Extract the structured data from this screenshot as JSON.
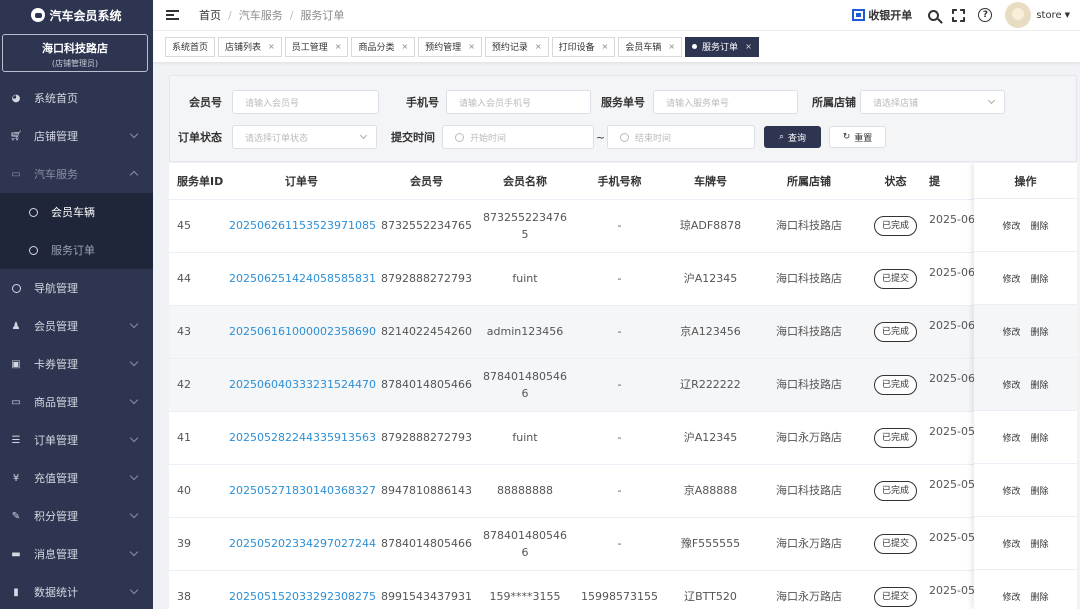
{
  "app": {
    "title": "汽车会员系统"
  },
  "store": {
    "name": "海口科技路店",
    "role": "(店铺管理员)"
  },
  "menu": {
    "items": [
      {
        "label": "系统首页",
        "icon": "dashboard-icon"
      },
      {
        "label": "店铺管理",
        "icon": "cart-icon"
      },
      {
        "label": "汽车服务",
        "icon": "briefcase-icon"
      },
      {
        "label": "导航管理",
        "icon": "compass-icon"
      },
      {
        "label": "会员管理",
        "icon": "users-icon"
      },
      {
        "label": "卡券管理",
        "icon": "ticket-icon"
      },
      {
        "label": "商品管理",
        "icon": "monitor-icon"
      },
      {
        "label": "订单管理",
        "icon": "list-icon"
      },
      {
        "label": "充值管理",
        "icon": "yen-icon"
      },
      {
        "label": "积分管理",
        "icon": "edit-icon"
      },
      {
        "label": "消息管理",
        "icon": "message-icon"
      },
      {
        "label": "数据统计",
        "icon": "chart-icon"
      }
    ],
    "sub": [
      {
        "label": "会员车辆"
      },
      {
        "label": "服务订单"
      }
    ]
  },
  "header": {
    "breadcrumb": [
      "首页",
      "汽车服务",
      "服务订单"
    ],
    "cashier": "收银开单",
    "username": "store"
  },
  "tabs": [
    {
      "label": "系统首页",
      "closable": false
    },
    {
      "label": "店铺列表",
      "closable": true
    },
    {
      "label": "员工管理",
      "closable": true
    },
    {
      "label": "商品分类",
      "closable": true
    },
    {
      "label": "预约管理",
      "closable": true
    },
    {
      "label": "预约记录",
      "closable": true
    },
    {
      "label": "打印设备",
      "closable": true
    },
    {
      "label": "会员车辆",
      "closable": true
    },
    {
      "label": "服务订单",
      "closable": true,
      "active": true
    }
  ],
  "filter": {
    "member_no": {
      "label": "会员号",
      "placeholder": "请输入会员号"
    },
    "phone": {
      "label": "手机号",
      "placeholder": "请输入会员手机号"
    },
    "service_no": {
      "label": "服务单号",
      "placeholder": "请输入服务单号"
    },
    "store": {
      "label": "所属店铺",
      "placeholder": "请选择店铺"
    },
    "order_status": {
      "label": "订单状态",
      "placeholder": "请选择订单状态"
    },
    "submit_time": {
      "label": "提交时间",
      "start_placeholder": "开始时间",
      "separator": "~",
      "end_placeholder": "结束时间"
    },
    "query_button": "查询",
    "reset_button": "重置"
  },
  "table": {
    "headers": [
      "服务单ID",
      "订单号",
      "会员号",
      "会员名称",
      "手机号称",
      "车牌号",
      "所属店铺",
      "状态",
      "提",
      "操作"
    ],
    "edit_label": "修改",
    "delete_label": "删除",
    "rows": [
      {
        "id": "45",
        "order": "20250626115352397108​5",
        "member_no": "8732552234765",
        "member_name": "873255223476\n5",
        "phone": "-",
        "plate": "琼ADF8878",
        "store": "海口科技路店",
        "status": "已完成",
        "date": "2025-06"
      },
      {
        "id": "44",
        "order": "20250625142405858583​1",
        "member_no": "8792888272793",
        "member_name": "fuint",
        "phone": "-",
        "plate": "沪A12345",
        "store": "海口科技路店",
        "status": "已提交",
        "date": "2025-06"
      },
      {
        "id": "43",
        "order": "20250616100000235869​0",
        "member_no": "8214022454260",
        "member_name": "admin123456",
        "phone": "-",
        "plate": "京A123456",
        "store": "海口科技路店",
        "status": "已完成",
        "date": "2025-06"
      },
      {
        "id": "42",
        "order": "20250604033323152447​0",
        "member_no": "8784014805466",
        "member_name": "878401480546\n6",
        "phone": "-",
        "plate": "辽R222222",
        "store": "海口科技路店",
        "status": "已完成",
        "date": "2025-06"
      },
      {
        "id": "41",
        "order": "20250528224433591356​3",
        "member_no": "8792888272793",
        "member_name": "fuint",
        "phone": "-",
        "plate": "沪A12345",
        "store": "海口永万路店",
        "status": "已完成",
        "date": "2025-05"
      },
      {
        "id": "40",
        "order": "20250527183014036832​7",
        "member_no": "8947810886143",
        "member_name": "88888888",
        "phone": "-",
        "plate": "京A88888",
        "store": "海口科技路店",
        "status": "已完成",
        "date": "2025-05"
      },
      {
        "id": "39",
        "order": "20250520233429702724​4",
        "member_no": "8784014805466",
        "member_name": "878401480546\n6",
        "phone": "-",
        "plate": "豫F555555",
        "store": "海口永万路店",
        "status": "已提交",
        "date": "2025-05"
      },
      {
        "id": "38",
        "order": "20250515203329230827​5",
        "member_no": "8991543437931",
        "member_name": "159****3155",
        "phone": "15998573155",
        "plate": "辽BTT520",
        "store": "海口永万路店",
        "status": "已提交",
        "date": "2025-05"
      }
    ]
  }
}
